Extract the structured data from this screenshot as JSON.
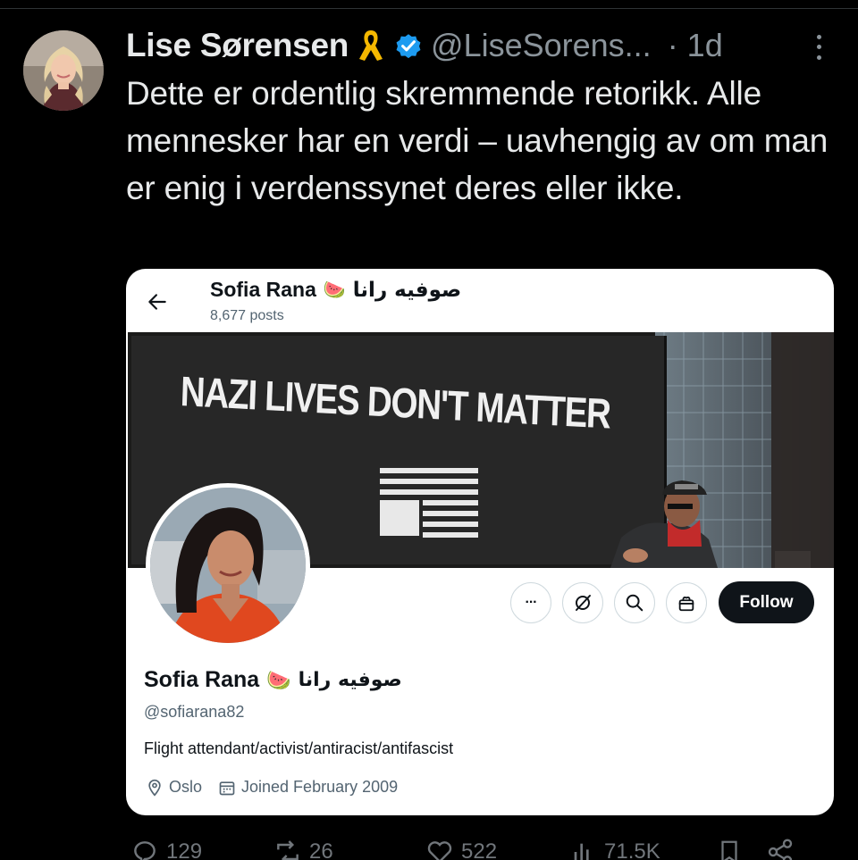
{
  "tweet": {
    "author_name": "Lise Sørensen",
    "handle": "@LiseSorens...",
    "time": "· 1d",
    "text": "Dette er ordentlig skremmende retorikk. Alle mennesker har en verdi – uavhengig av om man er enig i verdenssynet deres eller ikke.",
    "badge_icons": [
      "yellow-ribbon-icon",
      "verified-badge-icon"
    ]
  },
  "embedded_profile": {
    "header_name": "Sofia Rana",
    "header_emoji": "🍉",
    "header_arabic": "صوفيه رانا",
    "posts_count": "8,677 posts",
    "banner": {
      "text": "NAZI LIVES DON'T MATTER"
    },
    "buttons": {
      "more": "···",
      "follow": "Follow"
    },
    "name": "Sofia Rana",
    "handle": "@sofiarana82",
    "bio": "Flight attendant/activist/antiracist/antifascist",
    "location": "Oslo",
    "joined": "Joined February 2009"
  },
  "actions": {
    "replies": "129",
    "reposts": "26",
    "likes": "522",
    "views": "71.5K"
  },
  "colors": {
    "background": "#000000",
    "text_primary": "#e7e9ea",
    "text_secondary": "#8b949b",
    "verified_blue": "#1d9bf0",
    "ribbon_yellow": "#f5b800",
    "card_background": "#ffffff",
    "follow_button": "#0f1419"
  }
}
